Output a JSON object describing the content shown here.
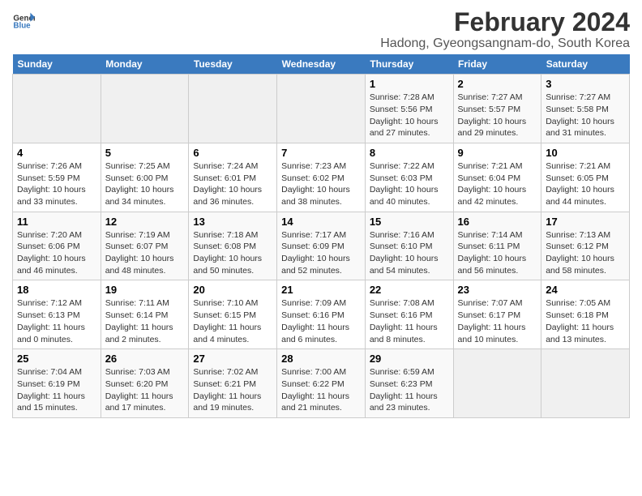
{
  "app": {
    "name": "GeneralBlue",
    "logo_symbol": "▶"
  },
  "calendar": {
    "month_year": "February 2024",
    "location": "Hadong, Gyeongsangnam-do, South Korea",
    "headers": [
      "Sunday",
      "Monday",
      "Tuesday",
      "Wednesday",
      "Thursday",
      "Friday",
      "Saturday"
    ],
    "weeks": [
      [
        {
          "day": "",
          "info": ""
        },
        {
          "day": "",
          "info": ""
        },
        {
          "day": "",
          "info": ""
        },
        {
          "day": "",
          "info": ""
        },
        {
          "day": "1",
          "info": "Sunrise: 7:28 AM\nSunset: 5:56 PM\nDaylight: 10 hours\nand 27 minutes."
        },
        {
          "day": "2",
          "info": "Sunrise: 7:27 AM\nSunset: 5:57 PM\nDaylight: 10 hours\nand 29 minutes."
        },
        {
          "day": "3",
          "info": "Sunrise: 7:27 AM\nSunset: 5:58 PM\nDaylight: 10 hours\nand 31 minutes."
        }
      ],
      [
        {
          "day": "4",
          "info": "Sunrise: 7:26 AM\nSunset: 5:59 PM\nDaylight: 10 hours\nand 33 minutes."
        },
        {
          "day": "5",
          "info": "Sunrise: 7:25 AM\nSunset: 6:00 PM\nDaylight: 10 hours\nand 34 minutes."
        },
        {
          "day": "6",
          "info": "Sunrise: 7:24 AM\nSunset: 6:01 PM\nDaylight: 10 hours\nand 36 minutes."
        },
        {
          "day": "7",
          "info": "Sunrise: 7:23 AM\nSunset: 6:02 PM\nDaylight: 10 hours\nand 38 minutes."
        },
        {
          "day": "8",
          "info": "Sunrise: 7:22 AM\nSunset: 6:03 PM\nDaylight: 10 hours\nand 40 minutes."
        },
        {
          "day": "9",
          "info": "Sunrise: 7:21 AM\nSunset: 6:04 PM\nDaylight: 10 hours\nand 42 minutes."
        },
        {
          "day": "10",
          "info": "Sunrise: 7:21 AM\nSunset: 6:05 PM\nDaylight: 10 hours\nand 44 minutes."
        }
      ],
      [
        {
          "day": "11",
          "info": "Sunrise: 7:20 AM\nSunset: 6:06 PM\nDaylight: 10 hours\nand 46 minutes."
        },
        {
          "day": "12",
          "info": "Sunrise: 7:19 AM\nSunset: 6:07 PM\nDaylight: 10 hours\nand 48 minutes."
        },
        {
          "day": "13",
          "info": "Sunrise: 7:18 AM\nSunset: 6:08 PM\nDaylight: 10 hours\nand 50 minutes."
        },
        {
          "day": "14",
          "info": "Sunrise: 7:17 AM\nSunset: 6:09 PM\nDaylight: 10 hours\nand 52 minutes."
        },
        {
          "day": "15",
          "info": "Sunrise: 7:16 AM\nSunset: 6:10 PM\nDaylight: 10 hours\nand 54 minutes."
        },
        {
          "day": "16",
          "info": "Sunrise: 7:14 AM\nSunset: 6:11 PM\nDaylight: 10 hours\nand 56 minutes."
        },
        {
          "day": "17",
          "info": "Sunrise: 7:13 AM\nSunset: 6:12 PM\nDaylight: 10 hours\nand 58 minutes."
        }
      ],
      [
        {
          "day": "18",
          "info": "Sunrise: 7:12 AM\nSunset: 6:13 PM\nDaylight: 11 hours\nand 0 minutes."
        },
        {
          "day": "19",
          "info": "Sunrise: 7:11 AM\nSunset: 6:14 PM\nDaylight: 11 hours\nand 2 minutes."
        },
        {
          "day": "20",
          "info": "Sunrise: 7:10 AM\nSunset: 6:15 PM\nDaylight: 11 hours\nand 4 minutes."
        },
        {
          "day": "21",
          "info": "Sunrise: 7:09 AM\nSunset: 6:16 PM\nDaylight: 11 hours\nand 6 minutes."
        },
        {
          "day": "22",
          "info": "Sunrise: 7:08 AM\nSunset: 6:16 PM\nDaylight: 11 hours\nand 8 minutes."
        },
        {
          "day": "23",
          "info": "Sunrise: 7:07 AM\nSunset: 6:17 PM\nDaylight: 11 hours\nand 10 minutes."
        },
        {
          "day": "24",
          "info": "Sunrise: 7:05 AM\nSunset: 6:18 PM\nDaylight: 11 hours\nand 13 minutes."
        }
      ],
      [
        {
          "day": "25",
          "info": "Sunrise: 7:04 AM\nSunset: 6:19 PM\nDaylight: 11 hours\nand 15 minutes."
        },
        {
          "day": "26",
          "info": "Sunrise: 7:03 AM\nSunset: 6:20 PM\nDaylight: 11 hours\nand 17 minutes."
        },
        {
          "day": "27",
          "info": "Sunrise: 7:02 AM\nSunset: 6:21 PM\nDaylight: 11 hours\nand 19 minutes."
        },
        {
          "day": "28",
          "info": "Sunrise: 7:00 AM\nSunset: 6:22 PM\nDaylight: 11 hours\nand 21 minutes."
        },
        {
          "day": "29",
          "info": "Sunrise: 6:59 AM\nSunset: 6:23 PM\nDaylight: 11 hours\nand 23 minutes."
        },
        {
          "day": "",
          "info": ""
        },
        {
          "day": "",
          "info": ""
        }
      ]
    ]
  }
}
